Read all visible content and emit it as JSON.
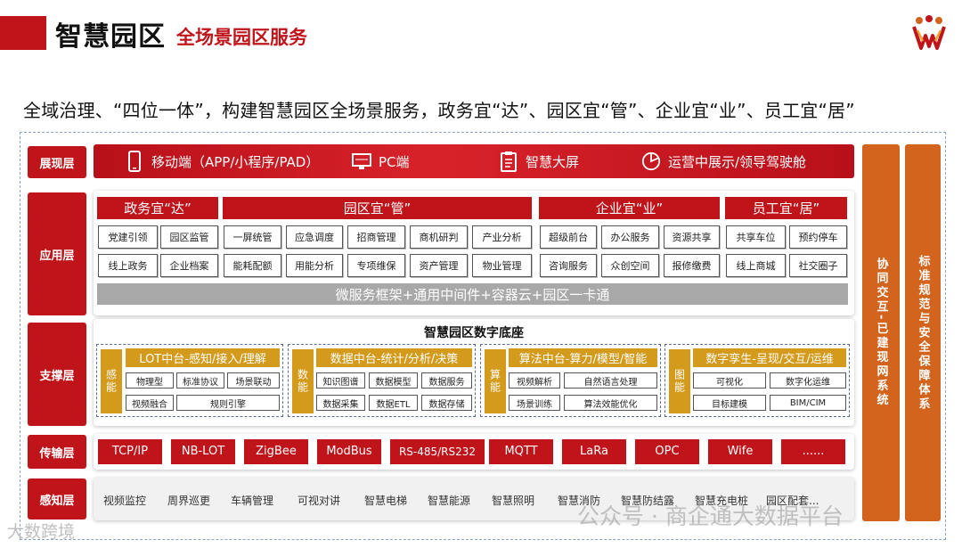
{
  "header": {
    "title": "智慧园区",
    "subtitle": "全场景园区服务",
    "tagline": "全域治理、“四位一体”，构建智慧园区全场景服务，政务宜“达”、园区宜“管”、企业宜“业”、员工宜“居”"
  },
  "layers": {
    "presentation": "展现层",
    "application": "应用层",
    "support": "支撑层",
    "transport": "传输层",
    "perception": "感知层"
  },
  "presentation": [
    {
      "label": "移动端（APP/小程序/PAD）",
      "icon": "mobile-icon"
    },
    {
      "label": "PC端",
      "icon": "monitor-icon"
    },
    {
      "label": "智慧大屏",
      "icon": "clipboard-icon"
    },
    {
      "label": "运营中展示/领导驾驶舱",
      "icon": "pie-chart-icon"
    }
  ],
  "application": {
    "heads": [
      "政务宜“达”",
      "园区宜“管”",
      "企业宜“业”",
      "员工宜“居”"
    ],
    "gov": [
      "党建引领",
      "园区监管",
      "线上政务",
      "企业档案"
    ],
    "park": [
      "一屏统管",
      "应急调度",
      "招商管理",
      "商机研判",
      "产业分析",
      "能耗配额",
      "用能分析",
      "专项维保",
      "资产管理",
      "物业管理"
    ],
    "ent": [
      "超级前台",
      "办公服务",
      "资源共享",
      "咨询服务",
      "众创空间",
      "报修缴费"
    ],
    "emp": [
      "共享车位",
      "预约停车",
      "线上商城",
      "社交圈子"
    ],
    "bar": "微服务框架+通用中间件+容器云+园区一卡通"
  },
  "support": {
    "title": "智慧园区数字底座",
    "groups": [
      {
        "tag": "感能",
        "head": "LOT中台-感知/接入/理解",
        "cells": [
          "物理型",
          "标准协议",
          "场景联动",
          "视频融合",
          "规则引擎"
        ]
      },
      {
        "tag": "数能",
        "head": "数据中台-统计/分析/决策",
        "cells": [
          "知识图谱",
          "数据模型",
          "数据服务",
          "数据采集",
          "数据ETL",
          "数据存储"
        ]
      },
      {
        "tag": "算能",
        "head": "算法中台-算力/模型/智能",
        "cells": [
          "视频解析",
          "自然语言处理",
          "场景训练",
          "算法效能优化"
        ]
      },
      {
        "tag": "图能",
        "head": "数字孪生-呈现/交互/运维",
        "cells": [
          "可视化",
          "数字化运维",
          "目标建模",
          "BIM/CIM"
        ]
      }
    ]
  },
  "transport": [
    "TCP/IP",
    "NB-LOT",
    "ZigBee",
    "ModBus",
    "RS-485/RS232",
    "MQTT",
    "LaRa",
    "OPC",
    "Wife",
    "......"
  ],
  "perception": [
    "视频监控",
    "周界巡更",
    "车辆管理",
    "可视对讲",
    "智慧电梯",
    "智慧能源",
    "智慧照明",
    "智慧消防",
    "智慧防结露",
    "智慧充电桩",
    "园区配套..."
  ],
  "right_bars": [
    "协同交互-已建现网系统",
    "标准规范与安全保障体系"
  ],
  "watermarks": [
    "公众号 · 商企通大数据平台",
    "大数跨境"
  ],
  "colors": {
    "primary_red": "#c0141b",
    "gold": "#d49a1c",
    "orange": "#d2641e",
    "gray_bar": "#a8a8a8"
  }
}
